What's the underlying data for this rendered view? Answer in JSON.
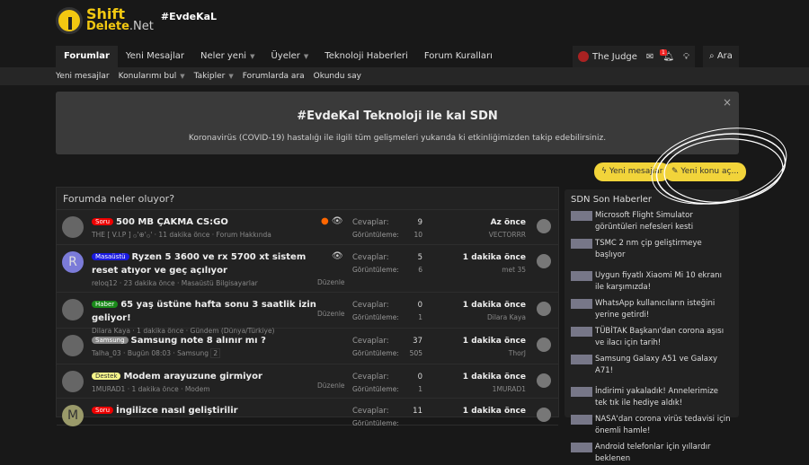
{
  "header": {
    "logo_line1": "Shift",
    "logo_line2a": "Delete",
    "logo_line2b": ".Net",
    "hashtag": "#EvdeKaL"
  },
  "nav": {
    "tabs": [
      "Forumlar",
      "Yeni Mesajlar",
      "Neler yeni",
      "Üyeler",
      "Teknoloji Haberleri",
      "Forum Kuralları"
    ],
    "user": "The Judge",
    "notif_count": "1",
    "search": "Ara"
  },
  "subnav": [
    "Yeni mesajlar",
    "Konularımı bul",
    "Takipler",
    "Forumlarda ara",
    "Okundu say"
  ],
  "banner": {
    "title": "#EvdeKal Teknoloji ile kal SDN",
    "text": "Koronavirüs (COVID-19) hastalığı ile ilgili tüm gelişmeleri yukarıda ki etkinliğimizden takip edebilirsiniz.",
    "close": "×"
  },
  "buttons": {
    "new_posts": "Yeni mesajlar",
    "new_thread": "Yeni konu aç..."
  },
  "panel": {
    "title": "Forumda neler oluyor?",
    "replies_label": "Cevaplar:",
    "views_label": "Görüntüleme:",
    "edit_label": "Düzenle",
    "threads": [
      {
        "prefix": "Soru",
        "prefix_color": "#e00",
        "title": "500 MB ÇAKMA CS:GO",
        "meta": "THE [ V.I.P ] ۞'⊕'۞' · 11 dakika önce · Forum Hakkında",
        "replies": "9",
        "views": "10",
        "last_time": "Az önce",
        "last_user": "VECTORRR",
        "avatar": ""
      },
      {
        "prefix": "Masaüstü",
        "prefix_color": "#1a1ae0",
        "title": "Ryzen 5 3600 ve rx 5700 xt sistem reset atıyor ve geç açılıyor",
        "meta": "reloq12 · 23 dakika önce · Masaüstü Bilgisayarlar",
        "replies": "5",
        "views": "6",
        "last_time": "1 dakika önce",
        "last_user": "met 35",
        "avatar": "R"
      },
      {
        "prefix": "Haber",
        "prefix_color": "#1a8a1a",
        "title": "65 yaş üstüne hafta sonu 3 saatlik izin geliyor!",
        "meta": "Dilara Kaya · 1 dakika önce · Gündem (Dünya/Türkiye)",
        "replies": "0",
        "views": "1",
        "last_time": "1 dakika önce",
        "last_user": "Dilara Kaya",
        "avatar": ""
      },
      {
        "prefix": "Samsung",
        "prefix_color": "#888",
        "title": "Samsung note 8 alınır mı ?",
        "meta": "Talha_03 · Bugün 08:03 · Samsung",
        "page": "2",
        "replies": "37",
        "views": "505",
        "last_time": "1 dakika önce",
        "last_user": "ThorJ",
        "avatar": ""
      },
      {
        "prefix": "Destek",
        "prefix_color": "#f5f58a",
        "title": "Modem arayuzune girmiyor",
        "meta": "1MURAD1 · 1 dakika önce · Modem",
        "replies": "0",
        "views": "1",
        "last_time": "1 dakika önce",
        "last_user": "1MURAD1",
        "avatar": ""
      },
      {
        "prefix": "Soru",
        "prefix_color": "#e00",
        "title": "İngilizce nasıl geliştirilir",
        "meta": "",
        "replies": "11",
        "views": "",
        "last_time": "1 dakika önce",
        "last_user": "",
        "avatar": "M"
      }
    ]
  },
  "sidebar": {
    "title": "SDN Son Haberler",
    "news": [
      "Microsoft Flight Simulator görüntüleri nefesleri kesti",
      "TSMC 2 nm çip geliştirmeye başlıyor",
      "Uygun fiyatlı Xiaomi Mi 10 ekranı ile karşımızda!",
      "WhatsApp kullanıcıların isteğini yerine getirdi!",
      "TÜBİTAK Başkanı'dan corona aşısı ve ilacı için tarih!",
      "Samsung Galaxy A51 ve Galaxy A71!",
      "İndirimi yakaladık! Annelerimize tek tık ile hediye aldık!",
      "NASA'dan corona virüs tedavisi için önemli hamle!",
      "Android telefonlar için yıllardır beklenen"
    ]
  }
}
